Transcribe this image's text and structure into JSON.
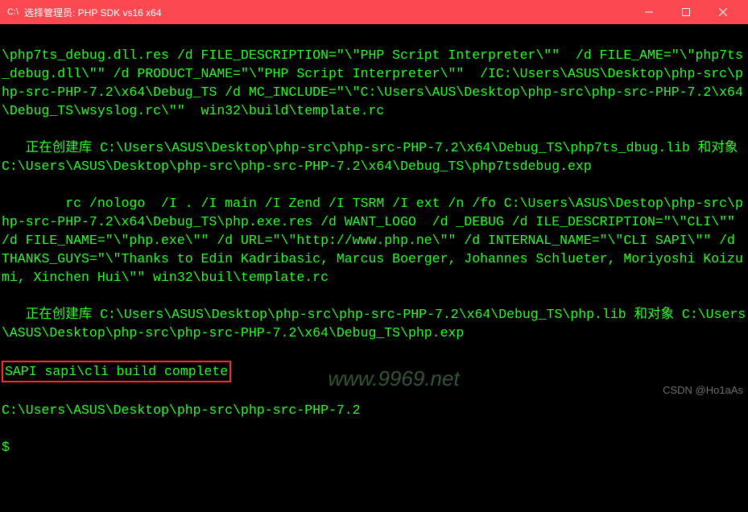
{
  "titlebar": {
    "icon_glyph": "C:\\",
    "title": "选择管理员:  PHP SDK vs16 x64"
  },
  "terminal": {
    "line1": "\\php7ts_debug.dll.res /d FILE_DESCRIPTION=\"\\\"PHP Script Interpreter\\\"\"  /d FILE_AME=\"\\\"php7ts_debug.dll\\\"\" /d PRODUCT_NAME=\"\\\"PHP Script Interpreter\\\"\"  /IC:\\Users\\ASUS\\Desktop\\php-src\\php-src-PHP-7.2\\x64\\Debug_TS /d MC_INCLUDE=\"\\\"C:\\Users\\AUS\\Desktop\\php-src\\php-src-PHP-7.2\\x64\\Debug_TS\\wsyslog.rc\\\"\"  win32\\build\\template.rc",
    "line2": "   正在创建库 C:\\Users\\ASUS\\Desktop\\php-src\\php-src-PHP-7.2\\x64\\Debug_TS\\php7ts_dbug.lib 和对象 C:\\Users\\ASUS\\Desktop\\php-src\\php-src-PHP-7.2\\x64\\Debug_TS\\php7tsdebug.exp",
    "line3": "        rc /nologo  /I . /I main /I Zend /I TSRM /I ext /n /fo C:\\Users\\ASUS\\Destop\\php-src\\php-src-PHP-7.2\\x64\\Debug_TS\\php.exe.res /d WANT_LOGO  /d _DEBUG /d ILE_DESCRIPTION=\"\\\"CLI\\\"\" /d FILE_NAME=\"\\\"php.exe\\\"\" /d URL=\"\\\"http://www.php.ne\\\"\" /d INTERNAL_NAME=\"\\\"CLI SAPI\\\"\" /d THANKS_GUYS=\"\\\"Thanks to Edin Kadribasic, Marcus Boerger, Johannes Schlueter, Moriyoshi Koizumi, Xinchen Hui\\\"\" win32\\buil\\template.rc",
    "line4": "   正在创建库 C:\\Users\\ASUS\\Desktop\\php-src\\php-src-PHP-7.2\\x64\\Debug_TS\\php.lib 和对象 C:\\Users\\ASUS\\Desktop\\php-src\\php-src-PHP-7.2\\x64\\Debug_TS\\php.exp",
    "line5": "SAPI sapi\\cli build complete",
    "blank": "",
    "prompt1": "C:\\Users\\ASUS\\Desktop\\php-src\\php-src-PHP-7.2",
    "prompt2": "$"
  },
  "watermarks": {
    "center": "www.9969.net",
    "right": "CSDN @Ho1aAs"
  }
}
